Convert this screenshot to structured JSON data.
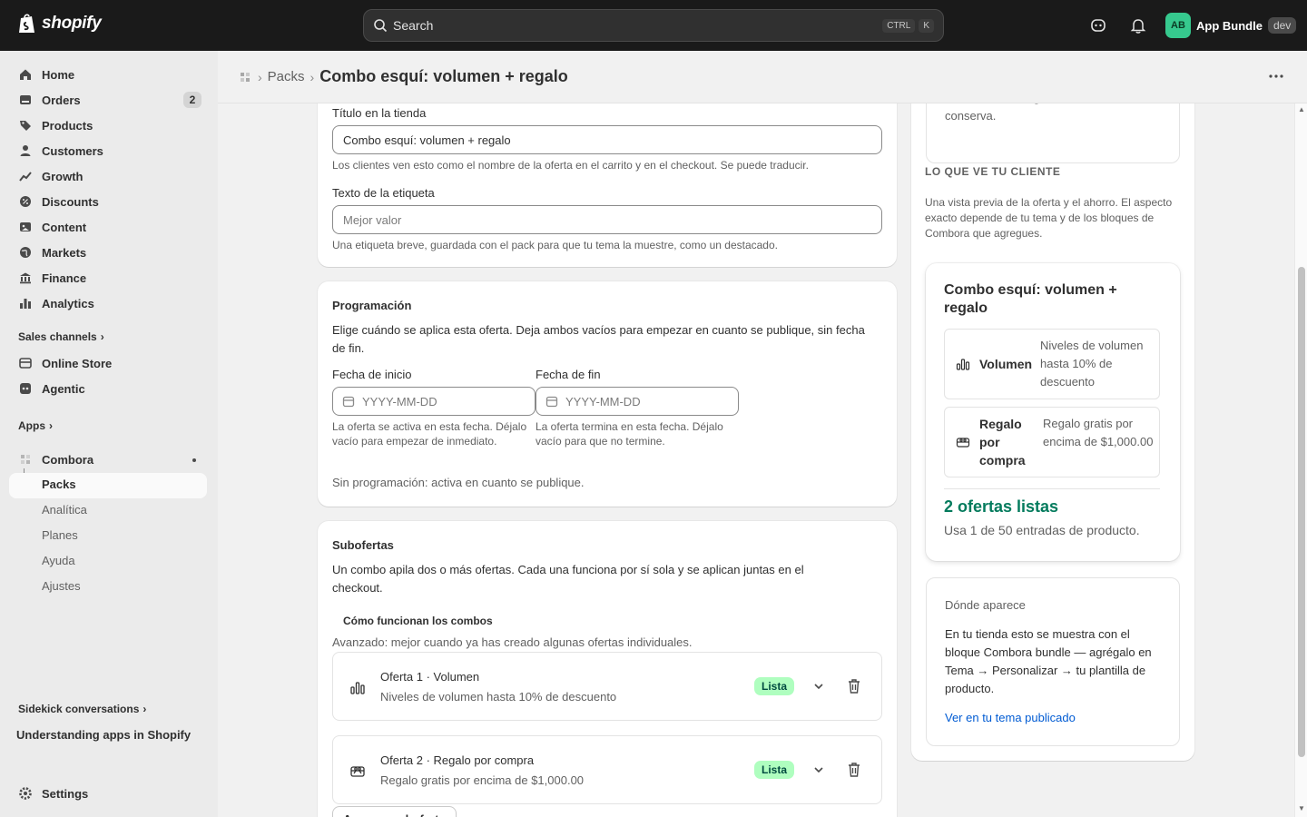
{
  "topbar": {
    "brand": "shopify",
    "search_placeholder": "Search",
    "shortcut_ctrl": "CTRL",
    "shortcut_key": "K",
    "store_initials": "AB",
    "store_name": "App Bundle",
    "store_tag": "dev"
  },
  "sidebar": {
    "items": [
      {
        "label": "Home",
        "icon": "home-icon"
      },
      {
        "label": "Orders",
        "icon": "orders-icon",
        "badge": "2"
      },
      {
        "label": "Products",
        "icon": "tag-icon"
      },
      {
        "label": "Customers",
        "icon": "person-icon"
      },
      {
        "label": "Growth",
        "icon": "growth-icon"
      },
      {
        "label": "Discounts",
        "icon": "discount-icon"
      },
      {
        "label": "Content",
        "icon": "content-icon"
      },
      {
        "label": "Markets",
        "icon": "globe-icon"
      },
      {
        "label": "Finance",
        "icon": "bank-icon"
      },
      {
        "label": "Analytics",
        "icon": "chart-icon"
      }
    ],
    "sales_channels_label": "Sales channels",
    "channels": [
      {
        "label": "Online Store",
        "icon": "store-icon"
      },
      {
        "label": "Agentic",
        "icon": "agent-icon"
      }
    ],
    "apps_label": "Apps",
    "app_name": "Combora",
    "app_subitems": [
      "Packs",
      "Analítica",
      "Planes",
      "Ayuda",
      "Ajustes"
    ],
    "sidekick_label": "Sidekick conversations",
    "sidekick_item": "Understanding apps in Shopify",
    "settings_label": "Settings"
  },
  "breadcrumb": {
    "parent": "Packs",
    "title": "Combo esquí: volumen + regalo"
  },
  "store_card": {
    "title_label": "Título en la tienda",
    "title_value": "Combo esquí: volumen + regalo",
    "title_help": "Los clientes ven esto como el nombre de la oferta en el carrito y en el checkout. Se puede traducir.",
    "tag_label": "Texto de la etiqueta",
    "tag_placeholder": "Mejor valor",
    "tag_help": "Una etiqueta breve, guardada con el pack para que tu tema la muestre, como un destacado."
  },
  "schedule": {
    "heading": "Programación",
    "description": "Elige cuándo se aplica esta oferta. Deja ambos vacíos para empezar en cuanto se publique, sin fecha de fin.",
    "start_label": "Fecha de inicio",
    "start_placeholder": "YYYY-MM-DD",
    "start_help": "La oferta se activa en esta fecha. Déjalo vacío para empezar de inmediato.",
    "end_label": "Fecha de fin",
    "end_placeholder": "YYYY-MM-DD",
    "end_help": "La oferta termina en esta fecha. Déjalo vacío para que no termine.",
    "status": "Sin programación: activa en cuanto se publique."
  },
  "suboffers": {
    "heading": "Subofertas",
    "description": "Un combo apila dos o más ofertas. Cada una funciona por sí sola y se aplican juntas en el checkout.",
    "how_link": "Cómo funcionan los combos",
    "advanced_note": "Avanzado: mejor cuando ya has creado algunas ofertas individuales.",
    "offers": [
      {
        "title": "Oferta 1 · Volumen",
        "desc": "Niveles de volumen hasta 10% de descuento",
        "status": "Lista",
        "icon": "bar-chart-icon"
      },
      {
        "title": "Oferta 2 · Regalo por compra",
        "desc": "Regalo gratis por encima de $1,000.00",
        "status": "Lista",
        "icon": "gift-icon"
      }
    ],
    "add_button": "Agregar suboferta"
  },
  "side": {
    "draft_note": "Pasar a borrador retira el pack de tu tienda — tu configuración se conserva.",
    "customer_heading": "LO QUE VE TU CLIENTE",
    "customer_desc": "Una vista previa de la oferta y el ahorro. El aspecto exacto depende de tu tema y de los bloques de Combora que agregues.",
    "preview": {
      "title": "Combo esquí: volumen + regalo",
      "rows": [
        {
          "name": "Volumen",
          "desc": "Niveles de volumen hasta 10% de descuento"
        },
        {
          "name": "Regalo por compra",
          "desc": "Regalo gratis por encima de $1,000.00"
        }
      ],
      "ready": "2 ofertas listas",
      "usage": "Usa 1 de 50 entradas de producto."
    },
    "where_heading": "Dónde aparece",
    "where_desc": "En tu tienda esto se muestra con el bloque Combora bundle — agrégalo en Tema → Personalizar → tu plantilla de producto.",
    "where_link": "Ver en tu tema publicado"
  },
  "colors": {
    "topbar": "#1a1a1a",
    "success_text": "#047b5d",
    "pill_bg": "#affebf",
    "link": "#005bd3"
  }
}
